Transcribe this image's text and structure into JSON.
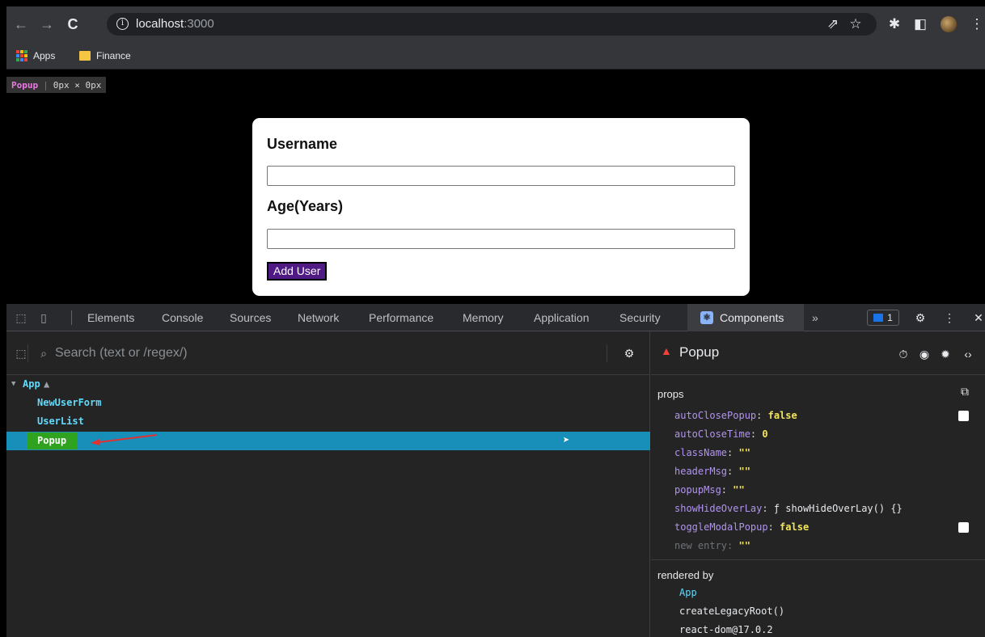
{
  "browser": {
    "url_host": "localhost",
    "url_port": ":3000",
    "bookmarks": [
      "Apps",
      "Finance"
    ]
  },
  "overlay": {
    "component": "Popup",
    "size": "0px × 0px"
  },
  "form": {
    "username_label": "Username",
    "age_label": "Age(Years)",
    "username_value": "",
    "age_value": "",
    "submit_label": "Add User"
  },
  "devtools": {
    "tabs": [
      "Elements",
      "Console",
      "Sources",
      "Network",
      "Performance",
      "Memory",
      "Application",
      "Security",
      "Components"
    ],
    "active_tab": "Components",
    "overflow": "»",
    "issues_count": "1",
    "search_placeholder": "Search (text or /regex/)",
    "tree": [
      {
        "label": "App",
        "level": 0,
        "expanded": true,
        "warning": true
      },
      {
        "label": "NewUserForm",
        "level": 1
      },
      {
        "label": "UserList",
        "level": 1
      },
      {
        "label": "Popup",
        "level": 1,
        "selected": true
      }
    ],
    "selected_component": "Popup",
    "props_title": "props",
    "props": [
      {
        "key": "autoClosePopup",
        "value": "false",
        "checkbox": true
      },
      {
        "key": "autoCloseTime",
        "value": "0"
      },
      {
        "key": "className",
        "value": "\"\""
      },
      {
        "key": "headerMsg",
        "value": "\"\""
      },
      {
        "key": "popupMsg",
        "value": "\"\""
      },
      {
        "key": "showHideOverLay",
        "value": "ƒ showHideOverLay() {}"
      },
      {
        "key": "toggleModalPopup",
        "value": "false",
        "checkbox": true
      },
      {
        "key": "new entry",
        "value": "\"\"",
        "placeholder": true
      }
    ],
    "rendered_by_title": "rendered by",
    "rendered_by": [
      "App",
      "createLegacyRoot()",
      "react-dom@17.0.2"
    ]
  },
  "colors": {
    "selected_row": "#178fb9",
    "selected_label": "#2fa31f",
    "prop_key": "#b294f0",
    "prop_value": "#f2e45a",
    "component_name": "#61dafb",
    "warning": "#f44336",
    "button": "#4f1a84"
  }
}
